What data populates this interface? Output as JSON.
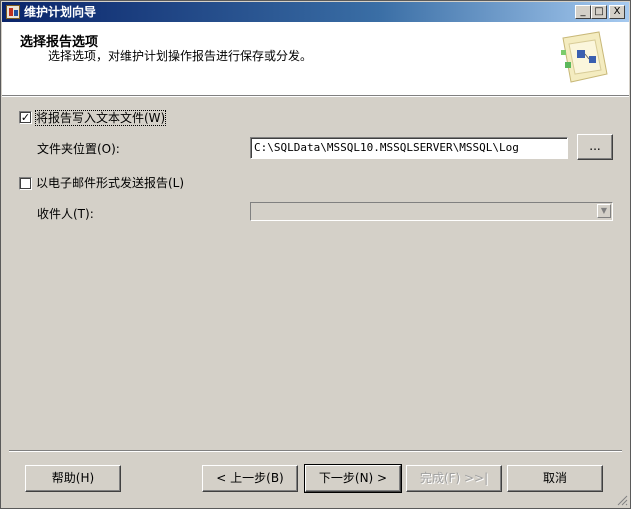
{
  "window": {
    "title": "维护计划向导",
    "controls": {
      "minimize": "_",
      "maximize": "□",
      "close": "X"
    }
  },
  "header": {
    "title": "选择报告选项",
    "subtitle": "选择选项，对维护计划操作报告进行保存或分发。",
    "art_icon": "wizard-illustration-icon"
  },
  "options": {
    "write_to_file": {
      "label": "将报告写入文本文件(W)",
      "checked": true,
      "check_glyph": "✓"
    },
    "folder_location": {
      "label": "文件夹位置(O):",
      "value": "C:\\SQLData\\MSSQL10.MSSQLSERVER\\MSSQL\\Log",
      "browse_label": "..."
    },
    "email_report": {
      "label": "以电子邮件形式发送报告(L)",
      "checked": false
    },
    "recipient": {
      "label": "收件人(T):",
      "value": "",
      "dropdown_glyph": "▼"
    }
  },
  "footer": {
    "help": "帮助(H)",
    "back": "< 上一步(B)",
    "next": "下一步(N) >",
    "finish": "完成(F) >>|",
    "cancel": "取消"
  },
  "colors": {
    "title_bar_start": "#0a246a",
    "title_bar_end": "#a6caf0",
    "dialog_face": "#d4d0c8"
  }
}
